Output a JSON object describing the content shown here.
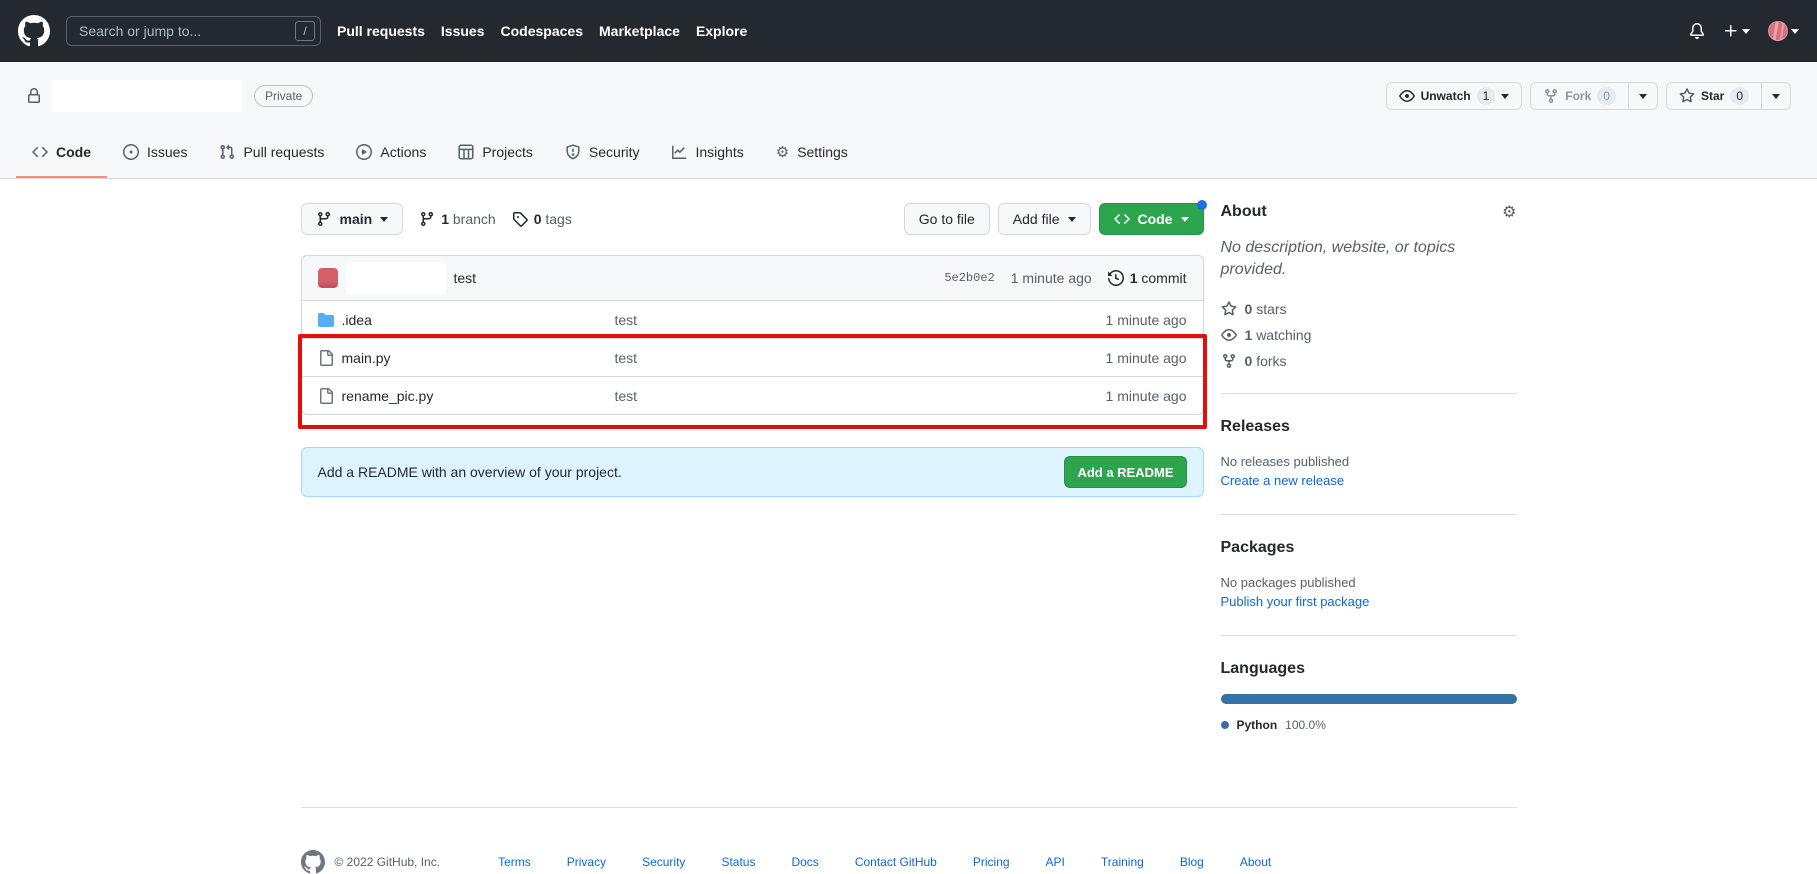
{
  "header": {
    "search_placeholder": "Search or jump to...",
    "search_shortcut": "/",
    "nav": [
      {
        "label": "Pull requests"
      },
      {
        "label": "Issues"
      },
      {
        "label": "Codespaces"
      },
      {
        "label": "Marketplace"
      },
      {
        "label": "Explore"
      }
    ]
  },
  "repo": {
    "visibility": "Private",
    "actions": {
      "unwatch": {
        "label": "Unwatch",
        "count": "1",
        "icon": "eye-icon"
      },
      "fork": {
        "label": "Fork",
        "count": "0",
        "icon": "fork-icon"
      },
      "star": {
        "label": "Star",
        "count": "0",
        "icon": "star-icon"
      }
    }
  },
  "tabs": [
    {
      "label": "Code",
      "icon": "code-icon",
      "active": true
    },
    {
      "label": "Issues",
      "icon": "issue-opened-icon"
    },
    {
      "label": "Pull requests",
      "icon": "pull-request-icon"
    },
    {
      "label": "Actions",
      "icon": "play-icon"
    },
    {
      "label": "Projects",
      "icon": "table-icon"
    },
    {
      "label": "Security",
      "icon": "shield-icon"
    },
    {
      "label": "Insights",
      "icon": "graph-icon"
    },
    {
      "label": "Settings",
      "icon": "gear-icon"
    }
  ],
  "toolbar": {
    "branch_button_label": "main",
    "branches": {
      "count": "1",
      "label": "branch",
      "icon": "branch-icon"
    },
    "tags": {
      "count": "0",
      "label": "tags",
      "icon": "tag-icon"
    },
    "goto_file_label": "Go to file",
    "add_file_label": "Add file",
    "code_button_label": "Code"
  },
  "commit_bar": {
    "message": "test",
    "sha": "5e2b0e2",
    "time": "1 minute ago",
    "count": "1",
    "count_label": "commit",
    "icon": "history-icon"
  },
  "files": [
    {
      "name": ".idea",
      "type": "folder",
      "icon": "folder-icon",
      "message": "test",
      "time": "1 minute ago",
      "highlighted": false
    },
    {
      "name": "main.py",
      "type": "file",
      "icon": "file-icon",
      "message": "test",
      "time": "1 minute ago",
      "highlighted": true
    },
    {
      "name": "rename_pic.py",
      "type": "file",
      "icon": "file-icon",
      "message": "test",
      "time": "1 minute ago",
      "highlighted": true
    }
  ],
  "readme_prompt": {
    "text": "Add a README with an overview of your project.",
    "button_label": "Add a README"
  },
  "sidebar": {
    "about": {
      "title": "About",
      "gear_icon": "gear-icon",
      "description": "No description, website, or topics provided.",
      "stats": [
        {
          "icon": "star-icon",
          "count": "0",
          "label": "stars"
        },
        {
          "icon": "eye-icon",
          "count": "1",
          "label": "watching"
        },
        {
          "icon": "fork-icon",
          "count": "0",
          "label": "forks"
        }
      ]
    },
    "releases": {
      "title": "Releases",
      "empty": "No releases published",
      "link": "Create a new release"
    },
    "packages": {
      "title": "Packages",
      "empty": "No packages published",
      "link": "Publish your first package"
    },
    "languages": {
      "title": "Languages",
      "items": [
        {
          "name": "Python",
          "percent": "100.0%",
          "color": "#3572a5"
        }
      ]
    }
  },
  "footer": {
    "copyright": "© 2022 GitHub, Inc.",
    "links": [
      "Terms",
      "Privacy",
      "Security",
      "Status",
      "Docs",
      "Contact GitHub",
      "Pricing",
      "API",
      "Training",
      "Blog",
      "About"
    ]
  },
  "colors": {
    "header_bg": "#24292f",
    "accent_green": "#2da44e",
    "link_blue": "#0969da",
    "tab_active_underline": "#fd8c73",
    "highlight_red": "#e60d0d",
    "readme_banner_bg": "#ddf4ff",
    "folder_blue": "#54aeff",
    "code_dot_blue": "#1f6feb"
  }
}
